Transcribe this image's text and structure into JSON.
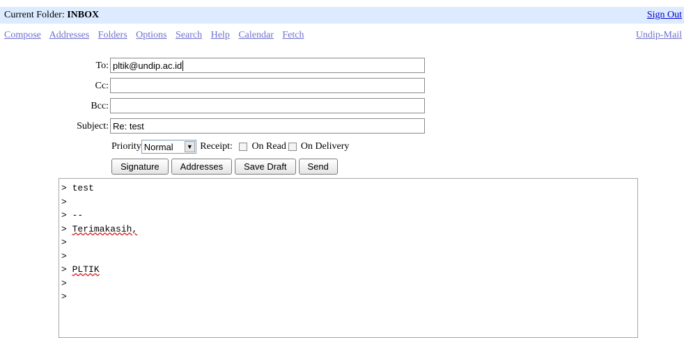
{
  "header": {
    "folder_label": "Current Folder:",
    "folder_name": "INBOX",
    "sign_out": "Sign Out",
    "site_link": "Undip-Mail"
  },
  "nav": [
    "Compose",
    "Addresses",
    "Folders",
    "Options",
    "Search",
    "Help",
    "Calendar",
    "Fetch"
  ],
  "compose": {
    "to_label": "To:",
    "to_value": "pltik@undip.ac.id",
    "cc_label": "Cc:",
    "cc_value": "",
    "bcc_label": "Bcc:",
    "bcc_value": "",
    "subject_label": "Subject:",
    "subject_value": "Re: test",
    "priority_label": "Priority",
    "priority_value": "Normal",
    "receipt_label": "Receipt:",
    "on_read_label": "On Read",
    "on_delivery_label": "On Delivery",
    "on_read_checked": false,
    "on_delivery_checked": false
  },
  "buttons": {
    "signature": "Signature",
    "addresses": "Addresses",
    "save_draft": "Save Draft",
    "send": "Send"
  },
  "message_lines": [
    {
      "prefix": "> ",
      "text": "test"
    },
    {
      "prefix": ">",
      "text": ""
    },
    {
      "prefix": "> ",
      "text": "--"
    },
    {
      "prefix": "> ",
      "text": "Terimakasih,"
    },
    {
      "prefix": ">",
      "text": ""
    },
    {
      "prefix": ">",
      "text": ""
    },
    {
      "prefix": "> ",
      "text": "PLTIK"
    },
    {
      "prefix": ">",
      "text": ""
    },
    {
      "prefix": ">",
      "text": ""
    }
  ]
}
